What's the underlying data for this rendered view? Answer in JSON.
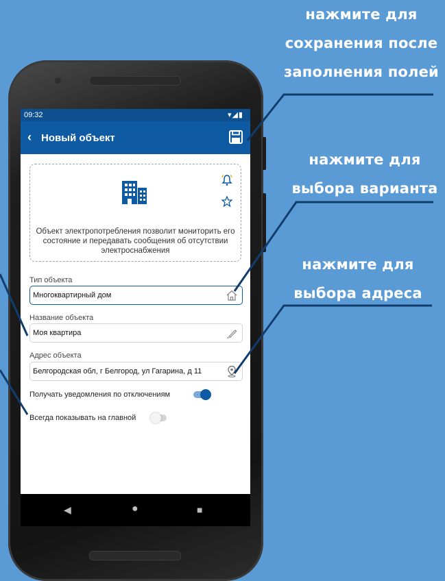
{
  "callouts": {
    "save": [
      "нажмите для",
      "сохранения после",
      "заполнения полей"
    ],
    "type": [
      "нажмите для",
      "выбора варианта"
    ],
    "address": [
      "нажмите для",
      "выбора адреса"
    ]
  },
  "status_bar": {
    "time": "09:32",
    "icons": "▾◢▮"
  },
  "app_bar": {
    "back_icon": "‹",
    "title": "Новый объект",
    "save_icon": "save-icon"
  },
  "info_card": {
    "icon": "building-icon",
    "description": "Объект электропотребления позволит мониторить его состояние и передавать сообщения об отсутствии электроснабжения"
  },
  "fields": {
    "type": {
      "label": "Тип объекта",
      "value": "Многоквартирный дом",
      "icon": "home-icon"
    },
    "name": {
      "label": "Название объекта",
      "value": "Моя квартира",
      "icon": "pencil-icon"
    },
    "address": {
      "label": "Адрес объекта",
      "value": "Белгородская обл, г Белгород, ул Гагарина, д 11",
      "icon": "location-pin-icon"
    }
  },
  "toggles": {
    "notifications": {
      "label": "Получать уведомления по отключениям",
      "on": true
    },
    "show_on_main": {
      "label": "Всегда показывать на главной",
      "on": false
    }
  },
  "nav": {
    "back": "◀",
    "home": "●",
    "recents": "■"
  },
  "colors": {
    "background": "#5b9bd5",
    "primary": "#0e5ba4",
    "status_bar": "#0e4f8f"
  }
}
